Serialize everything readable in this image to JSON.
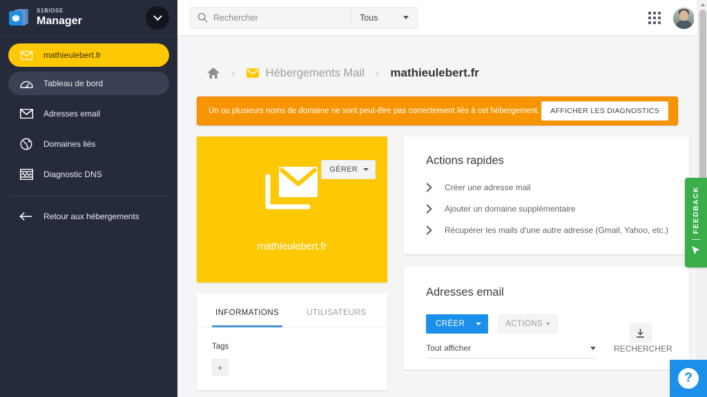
{
  "sidebar": {
    "brand": {
      "eyebrow": "S1BIOSE",
      "name": "Manager"
    },
    "toggle_icon": "chevron-down-icon",
    "items": [
      {
        "label": "mathieulebert.fr",
        "icon": "mail-icon",
        "state": "active-yellow"
      },
      {
        "label": "Tableau de bord",
        "icon": "dashboard-gauge-icon",
        "state": "active-grey"
      },
      {
        "label": "Adresses email",
        "icon": "envelope-icon",
        "state": "normal"
      },
      {
        "label": "Domaines liés",
        "icon": "globe-icon",
        "state": "normal"
      },
      {
        "label": "Diagnostic DNS",
        "icon": "dns-pulse-icon",
        "state": "normal"
      }
    ],
    "footer": {
      "label": "Retour aux hébergements",
      "icon": "arrow-left-icon"
    }
  },
  "topbar": {
    "search": {
      "placeholder": "Rechercher",
      "value": "",
      "icon": "search-icon"
    },
    "filter": {
      "value": "Tous",
      "icon": "chevron-down-icon"
    },
    "apps_icon": "grid-apps-icon",
    "avatar": "user-avatar"
  },
  "breadcrumb": {
    "home_icon": "home-icon",
    "separator": "›",
    "mail_icon": "mail-icon",
    "parent": "Hébergements Mail",
    "current": "mathieulebert.fr"
  },
  "alert": {
    "message": "Un ou plusieurs noms de domaine ne sont peut-être pas correctement liés à cet hébergement.",
    "button": "AFFICHER LES DIAGNOSTICS",
    "bg_color": "#f79500"
  },
  "hero": {
    "domain": "mathieulebert.fr",
    "manage_button": "GÉRER",
    "mail_icon": "mail-stack-icon",
    "bg_color": "#ffc805"
  },
  "info_card": {
    "tabs": [
      {
        "label": "INFORMATIONS",
        "selected": true
      },
      {
        "label": "UTILISATEURS",
        "selected": false
      }
    ],
    "tags_label": "Tags",
    "tag_add_button": "+"
  },
  "quick_actions": {
    "title": "Actions rapides",
    "items": [
      "Créer une adresse mail",
      "Ajouter un domaine supplémentaire",
      "Récupérer les mails d'une autre adresse (Gmail, Yahoo, etc.)"
    ]
  },
  "email_card": {
    "title": "Adresses email",
    "create_button": "CRÉER",
    "actions_button": "ACTIONS",
    "download_icon": "download-icon",
    "filter_value": "Tout afficher",
    "search_label": "RECHERCHER"
  },
  "feedback": {
    "label": "FEEDBACK",
    "icon": "cursor-arrow-icon",
    "color": "#3aae49"
  },
  "help": {
    "label": "?",
    "color": "#1b90ea"
  }
}
